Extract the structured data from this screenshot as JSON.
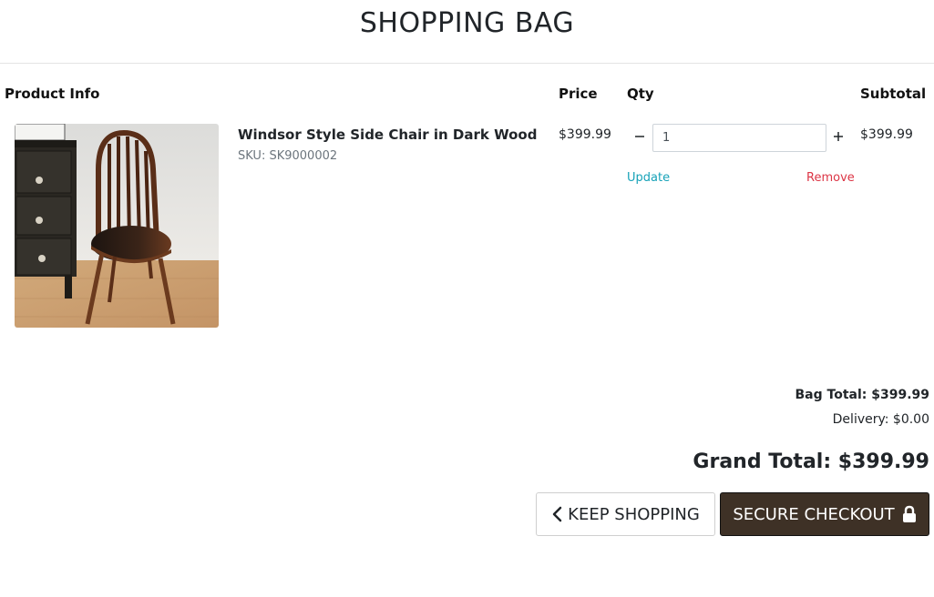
{
  "page": {
    "title": "SHOPPING BAG"
  },
  "table": {
    "headers": {
      "product": "Product Info",
      "price": "Price",
      "qty": "Qty",
      "subtotal": "Subtotal"
    }
  },
  "item": {
    "name": "Windsor Style Side Chair in Dark Wood",
    "sku": "SKU: SK9000002",
    "price": "$399.99",
    "quantity": "1",
    "subtotal": "$399.99",
    "update_label": "Update",
    "remove_label": "Remove"
  },
  "totals": {
    "bag_total": "Bag Total: $399.99",
    "delivery": "Delivery: $0.00",
    "grand_total": "Grand Total: $399.99"
  },
  "actions": {
    "keep_shopping": "KEEP SHOPPING",
    "secure_checkout": "SECURE CHECKOUT"
  },
  "icons": {
    "keep_shopping": "chevron-left-icon",
    "checkout": "lock-icon",
    "qty_decrease": "minus-icon",
    "qty_increase": "plus-icon"
  },
  "colors": {
    "update_link": "#17a2b8",
    "remove_link": "#dc3545",
    "checkout_bg": "#3e3126"
  }
}
